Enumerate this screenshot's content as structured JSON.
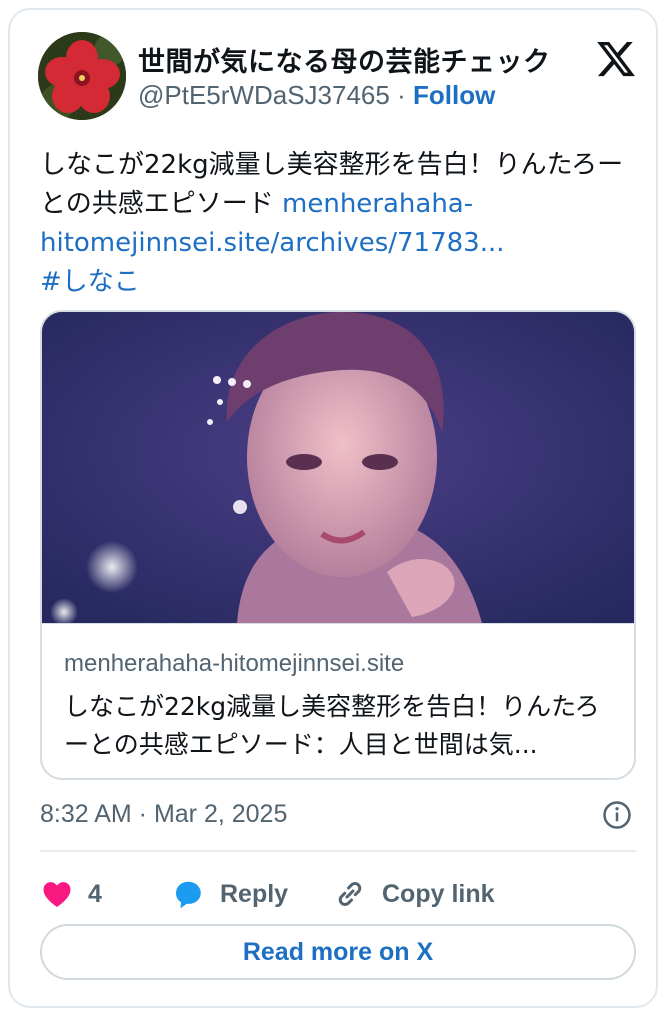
{
  "author": {
    "display_name": "世間が気になる母の芸能チェック",
    "handle": "@PtE5rWDaSJ37465",
    "separator": "·",
    "follow_label": "Follow",
    "avatar_icon": "red-flower-avatar"
  },
  "tweet": {
    "text": "しなこが22kg減量し美容整形を告白！りんたろーとの共感エピソード",
    "link_text": "menherahaha-hitomejinnsei.site/archives/71783...",
    "hashtag": "#しなこ",
    "timestamp": "8:32 AM · Mar 2, 2025"
  },
  "link_card": {
    "domain": "menherahaha-hitomejinnsei.site",
    "title": "しなこが22kg減量し美容整形を告白！りんたろーとの共感エピソード：人目と世間は気..."
  },
  "actions": {
    "like_count": "4",
    "reply_label": "Reply",
    "copy_link_label": "Copy link"
  },
  "read_more_label": "Read more on X",
  "colors": {
    "link_blue": "#1d6fc4",
    "heart_pink": "#f91880",
    "reply_blue": "#1d9bf0",
    "muted_text": "#536471",
    "main_text": "#0f1419"
  }
}
